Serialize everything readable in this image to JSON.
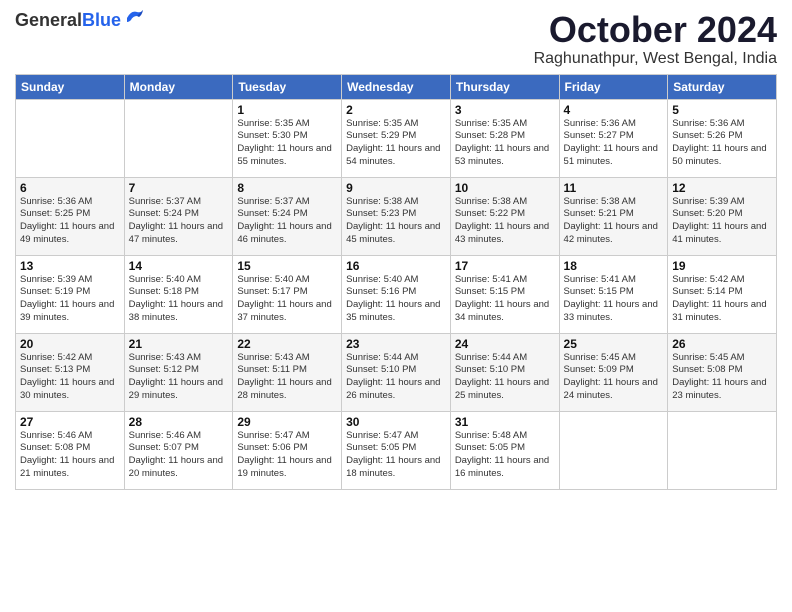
{
  "header": {
    "logo_general": "General",
    "logo_blue": "Blue",
    "month": "October 2024",
    "location": "Raghunathpur, West Bengal, India"
  },
  "columns": [
    "Sunday",
    "Monday",
    "Tuesday",
    "Wednesday",
    "Thursday",
    "Friday",
    "Saturday"
  ],
  "weeks": [
    [
      {
        "day": "",
        "info": ""
      },
      {
        "day": "",
        "info": ""
      },
      {
        "day": "1",
        "info": "Sunrise: 5:35 AM\nSunset: 5:30 PM\nDaylight: 11 hours and 55 minutes."
      },
      {
        "day": "2",
        "info": "Sunrise: 5:35 AM\nSunset: 5:29 PM\nDaylight: 11 hours and 54 minutes."
      },
      {
        "day": "3",
        "info": "Sunrise: 5:35 AM\nSunset: 5:28 PM\nDaylight: 11 hours and 53 minutes."
      },
      {
        "day": "4",
        "info": "Sunrise: 5:36 AM\nSunset: 5:27 PM\nDaylight: 11 hours and 51 minutes."
      },
      {
        "day": "5",
        "info": "Sunrise: 5:36 AM\nSunset: 5:26 PM\nDaylight: 11 hours and 50 minutes."
      }
    ],
    [
      {
        "day": "6",
        "info": "Sunrise: 5:36 AM\nSunset: 5:25 PM\nDaylight: 11 hours and 49 minutes."
      },
      {
        "day": "7",
        "info": "Sunrise: 5:37 AM\nSunset: 5:24 PM\nDaylight: 11 hours and 47 minutes."
      },
      {
        "day": "8",
        "info": "Sunrise: 5:37 AM\nSunset: 5:24 PM\nDaylight: 11 hours and 46 minutes."
      },
      {
        "day": "9",
        "info": "Sunrise: 5:38 AM\nSunset: 5:23 PM\nDaylight: 11 hours and 45 minutes."
      },
      {
        "day": "10",
        "info": "Sunrise: 5:38 AM\nSunset: 5:22 PM\nDaylight: 11 hours and 43 minutes."
      },
      {
        "day": "11",
        "info": "Sunrise: 5:38 AM\nSunset: 5:21 PM\nDaylight: 11 hours and 42 minutes."
      },
      {
        "day": "12",
        "info": "Sunrise: 5:39 AM\nSunset: 5:20 PM\nDaylight: 11 hours and 41 minutes."
      }
    ],
    [
      {
        "day": "13",
        "info": "Sunrise: 5:39 AM\nSunset: 5:19 PM\nDaylight: 11 hours and 39 minutes."
      },
      {
        "day": "14",
        "info": "Sunrise: 5:40 AM\nSunset: 5:18 PM\nDaylight: 11 hours and 38 minutes."
      },
      {
        "day": "15",
        "info": "Sunrise: 5:40 AM\nSunset: 5:17 PM\nDaylight: 11 hours and 37 minutes."
      },
      {
        "day": "16",
        "info": "Sunrise: 5:40 AM\nSunset: 5:16 PM\nDaylight: 11 hours and 35 minutes."
      },
      {
        "day": "17",
        "info": "Sunrise: 5:41 AM\nSunset: 5:15 PM\nDaylight: 11 hours and 34 minutes."
      },
      {
        "day": "18",
        "info": "Sunrise: 5:41 AM\nSunset: 5:15 PM\nDaylight: 11 hours and 33 minutes."
      },
      {
        "day": "19",
        "info": "Sunrise: 5:42 AM\nSunset: 5:14 PM\nDaylight: 11 hours and 31 minutes."
      }
    ],
    [
      {
        "day": "20",
        "info": "Sunrise: 5:42 AM\nSunset: 5:13 PM\nDaylight: 11 hours and 30 minutes."
      },
      {
        "day": "21",
        "info": "Sunrise: 5:43 AM\nSunset: 5:12 PM\nDaylight: 11 hours and 29 minutes."
      },
      {
        "day": "22",
        "info": "Sunrise: 5:43 AM\nSunset: 5:11 PM\nDaylight: 11 hours and 28 minutes."
      },
      {
        "day": "23",
        "info": "Sunrise: 5:44 AM\nSunset: 5:10 PM\nDaylight: 11 hours and 26 minutes."
      },
      {
        "day": "24",
        "info": "Sunrise: 5:44 AM\nSunset: 5:10 PM\nDaylight: 11 hours and 25 minutes."
      },
      {
        "day": "25",
        "info": "Sunrise: 5:45 AM\nSunset: 5:09 PM\nDaylight: 11 hours and 24 minutes."
      },
      {
        "day": "26",
        "info": "Sunrise: 5:45 AM\nSunset: 5:08 PM\nDaylight: 11 hours and 23 minutes."
      }
    ],
    [
      {
        "day": "27",
        "info": "Sunrise: 5:46 AM\nSunset: 5:08 PM\nDaylight: 11 hours and 21 minutes."
      },
      {
        "day": "28",
        "info": "Sunrise: 5:46 AM\nSunset: 5:07 PM\nDaylight: 11 hours and 20 minutes."
      },
      {
        "day": "29",
        "info": "Sunrise: 5:47 AM\nSunset: 5:06 PM\nDaylight: 11 hours and 19 minutes."
      },
      {
        "day": "30",
        "info": "Sunrise: 5:47 AM\nSunset: 5:05 PM\nDaylight: 11 hours and 18 minutes."
      },
      {
        "day": "31",
        "info": "Sunrise: 5:48 AM\nSunset: 5:05 PM\nDaylight: 11 hours and 16 minutes."
      },
      {
        "day": "",
        "info": ""
      },
      {
        "day": "",
        "info": ""
      }
    ]
  ]
}
